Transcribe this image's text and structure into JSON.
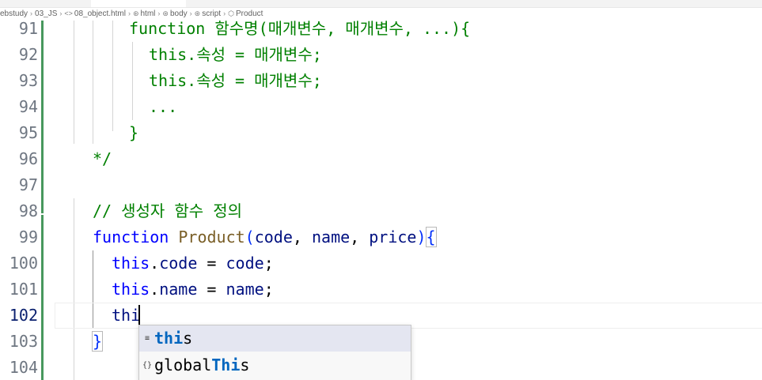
{
  "breadcrumb": {
    "items": [
      {
        "label": "ebstudy",
        "icon": ""
      },
      {
        "label": "03_JS",
        "icon": ""
      },
      {
        "label": "08_object.html",
        "icon": "<>"
      },
      {
        "label": "html",
        "icon": "⊛"
      },
      {
        "label": "body",
        "icon": "⊛"
      },
      {
        "label": "script",
        "icon": "⊛"
      },
      {
        "label": "Product",
        "icon": "⬡"
      }
    ]
  },
  "editor": {
    "active_line": "102",
    "lines": [
      {
        "num": "91",
        "text": "function 함수명(매개변수, 매개변수, ...){"
      },
      {
        "num": "92",
        "text": "this.속성 = 매개변수;"
      },
      {
        "num": "93",
        "text": "this.속성 = 매개변수;"
      },
      {
        "num": "94",
        "text": "..."
      },
      {
        "num": "95",
        "text": "}"
      },
      {
        "num": "96",
        "text": "*/"
      },
      {
        "num": "97",
        "text": ""
      },
      {
        "num": "98",
        "text": "// 생성자 함수 정의"
      },
      {
        "num": "99",
        "text": "function Product(code, name, price){"
      },
      {
        "num": "100",
        "text": "this.code = code;"
      },
      {
        "num": "101",
        "text": "this.name = name;"
      },
      {
        "num": "102",
        "text": "thi"
      },
      {
        "num": "103",
        "text": "}"
      },
      {
        "num": "104",
        "text": ""
      }
    ]
  },
  "code": {
    "l91_kw": "function",
    "l91_rest": " 함수명(매개변수, 매개변수, ...){",
    "l92": "this.속성 = 매개변수;",
    "l93": "this.속성 = 매개변수;",
    "l94": "...",
    "l95": "}",
    "l96": "*/",
    "l98": "// 생성자 함수 정의",
    "l99_kw": "function",
    "l99_fn": "Product",
    "l99_open": "(",
    "l99_p1": "code",
    "l99_c1": ", ",
    "l99_p2": "name",
    "l99_c2": ", ",
    "l99_p3": "price",
    "l99_close": ")",
    "l99_brace": "{",
    "l100_this": "this",
    "l100_rest_a": ".",
    "l100_prop": "code",
    "l100_eq": " = ",
    "l100_val": "code",
    "l100_semi": ";",
    "l101_this": "this",
    "l101_rest_a": ".",
    "l101_prop": "name",
    "l101_eq": " = ",
    "l101_val": "name",
    "l101_semi": ";",
    "l102_typed": "thi",
    "l103_brace": "}"
  },
  "suggest": {
    "items": [
      {
        "kind_icon": "keyword-icon",
        "kind_glyph": "≡",
        "match": "thi",
        "rest": "s",
        "selected": true
      },
      {
        "kind_icon": "variable-icon",
        "kind_glyph": "{}",
        "pre": "global",
        "match": "Thi",
        "rest": "s",
        "selected": false
      }
    ]
  },
  "colors": {
    "comment": "#008000",
    "keyword": "#0000ff",
    "function": "#795e26",
    "identifier": "#001080",
    "git_added": "#48985d",
    "suggest_match": "#0066bf",
    "suggest_selected_bg": "#e4e6f1"
  }
}
